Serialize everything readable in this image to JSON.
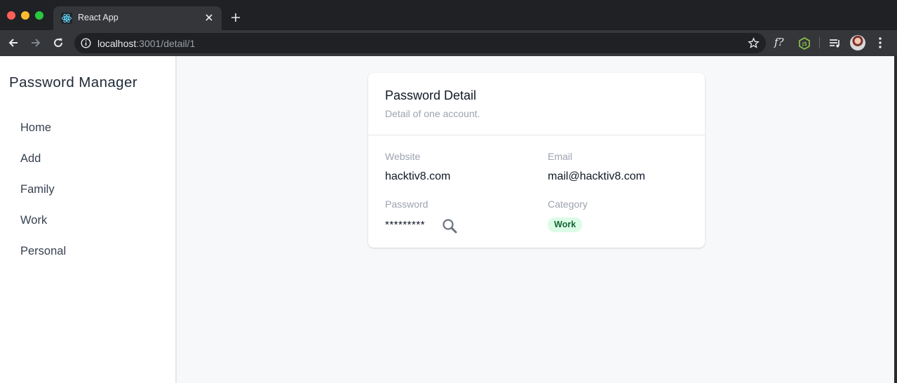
{
  "browser": {
    "tab_title": "React App",
    "url_host": "localhost",
    "url_path": ":3001/detail/1",
    "icons": [
      "react-favicon-icon",
      "close-icon",
      "plus-icon",
      "back-arrow-icon",
      "forward-arrow-icon",
      "reload-icon",
      "info-icon",
      "star-icon",
      "function-extension-icon",
      "nodejs-extension-icon",
      "media-control-icon",
      "avatar",
      "kebab-menu-icon"
    ],
    "ext_f_label": "f?"
  },
  "sidebar": {
    "brand": "Password Manager",
    "items": [
      {
        "label": "Home"
      },
      {
        "label": "Add"
      },
      {
        "label": "Family"
      },
      {
        "label": "Work"
      },
      {
        "label": "Personal"
      }
    ]
  },
  "card": {
    "title": "Password Detail",
    "subtitle": "Detail of one account.",
    "fields": {
      "website_label": "Website",
      "website_value": "hacktiv8.com",
      "email_label": "Email",
      "email_value": "mail@hacktiv8.com",
      "password_label": "Password",
      "password_value": "*********",
      "category_label": "Category",
      "category_value": "Work"
    }
  },
  "colors": {
    "accent_badge_bg": "#dcfce7",
    "accent_badge_text": "#166534",
    "page_bg": "#f7f8fa"
  }
}
